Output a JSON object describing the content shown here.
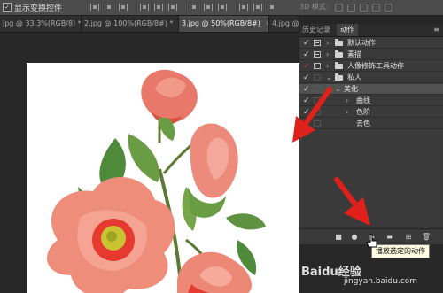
{
  "options_bar": {
    "checkbox_mark": "✓",
    "show_transform_controls_label": "显示变换控件",
    "mode_3d_label": "3D 模式:"
  },
  "document_tabs": [
    {
      "label": "jpg @ 33.3%(RGB/8) *",
      "active": false
    },
    {
      "label": "2.jpg @ 100%(RGB/8#) *",
      "active": false
    },
    {
      "label": "3.jpg @ 50%(RGB/8#)",
      "active": true
    },
    {
      "label": "4.jpg @",
      "active": false
    }
  ],
  "tab_close": "×",
  "panel": {
    "tabs": [
      {
        "label": "历史记录",
        "active": false
      },
      {
        "label": "动作",
        "active": true
      }
    ],
    "menu_icon": "≡",
    "rows": [
      {
        "check": "✓",
        "check_red": false,
        "dialog": true,
        "chevron": "›",
        "folder": true,
        "label": "默认动作",
        "selected": false
      },
      {
        "check": "✓",
        "check_red": false,
        "dialog": true,
        "chevron": "›",
        "folder": true,
        "label": "素描",
        "selected": false
      },
      {
        "check": "✓",
        "check_red": true,
        "dialog": true,
        "chevron": "›",
        "folder": true,
        "label": "人像修饰工具动作",
        "selected": false
      },
      {
        "check": "✓",
        "check_red": false,
        "dialog": false,
        "chevron": "⌄",
        "folder": true,
        "label": "私人",
        "selected": false
      },
      {
        "check": "✓",
        "check_red": false,
        "dialog": false,
        "chevron": "⌄",
        "folder": false,
        "label": "美化",
        "selected": true
      },
      {
        "check": "✓",
        "check_red": false,
        "dialog": false,
        "chevron": "›",
        "folder": false,
        "label": "曲线",
        "selected": false
      },
      {
        "check": "✓",
        "check_red": false,
        "dialog": false,
        "chevron": "›",
        "folder": false,
        "label": "色阶",
        "selected": false
      },
      {
        "check": "✓",
        "check_red": false,
        "dialog": false,
        "chevron": "",
        "folder": false,
        "label": "去色",
        "selected": false
      }
    ],
    "footer_buttons": [
      {
        "icon": "stop-icon",
        "glyph": "■"
      },
      {
        "icon": "record-icon",
        "glyph": "●"
      },
      {
        "icon": "play-icon",
        "glyph": "▶"
      },
      {
        "icon": "new-set-folder-icon",
        "glyph": "▬"
      },
      {
        "icon": "new-action-icon",
        "glyph": "⊞"
      },
      {
        "icon": "delete-icon",
        "glyph": "🗑"
      }
    ],
    "tooltip": "播放选定的动作"
  },
  "watermark": {
    "brand": "Baidu经验",
    "url": "jingyan.baidu.com"
  },
  "colors": {
    "annotation_arrow": "#e0211b",
    "panel_bg": "#3a3a3a",
    "selected_row": "#515151",
    "canvas_bg": "#ffffff"
  }
}
